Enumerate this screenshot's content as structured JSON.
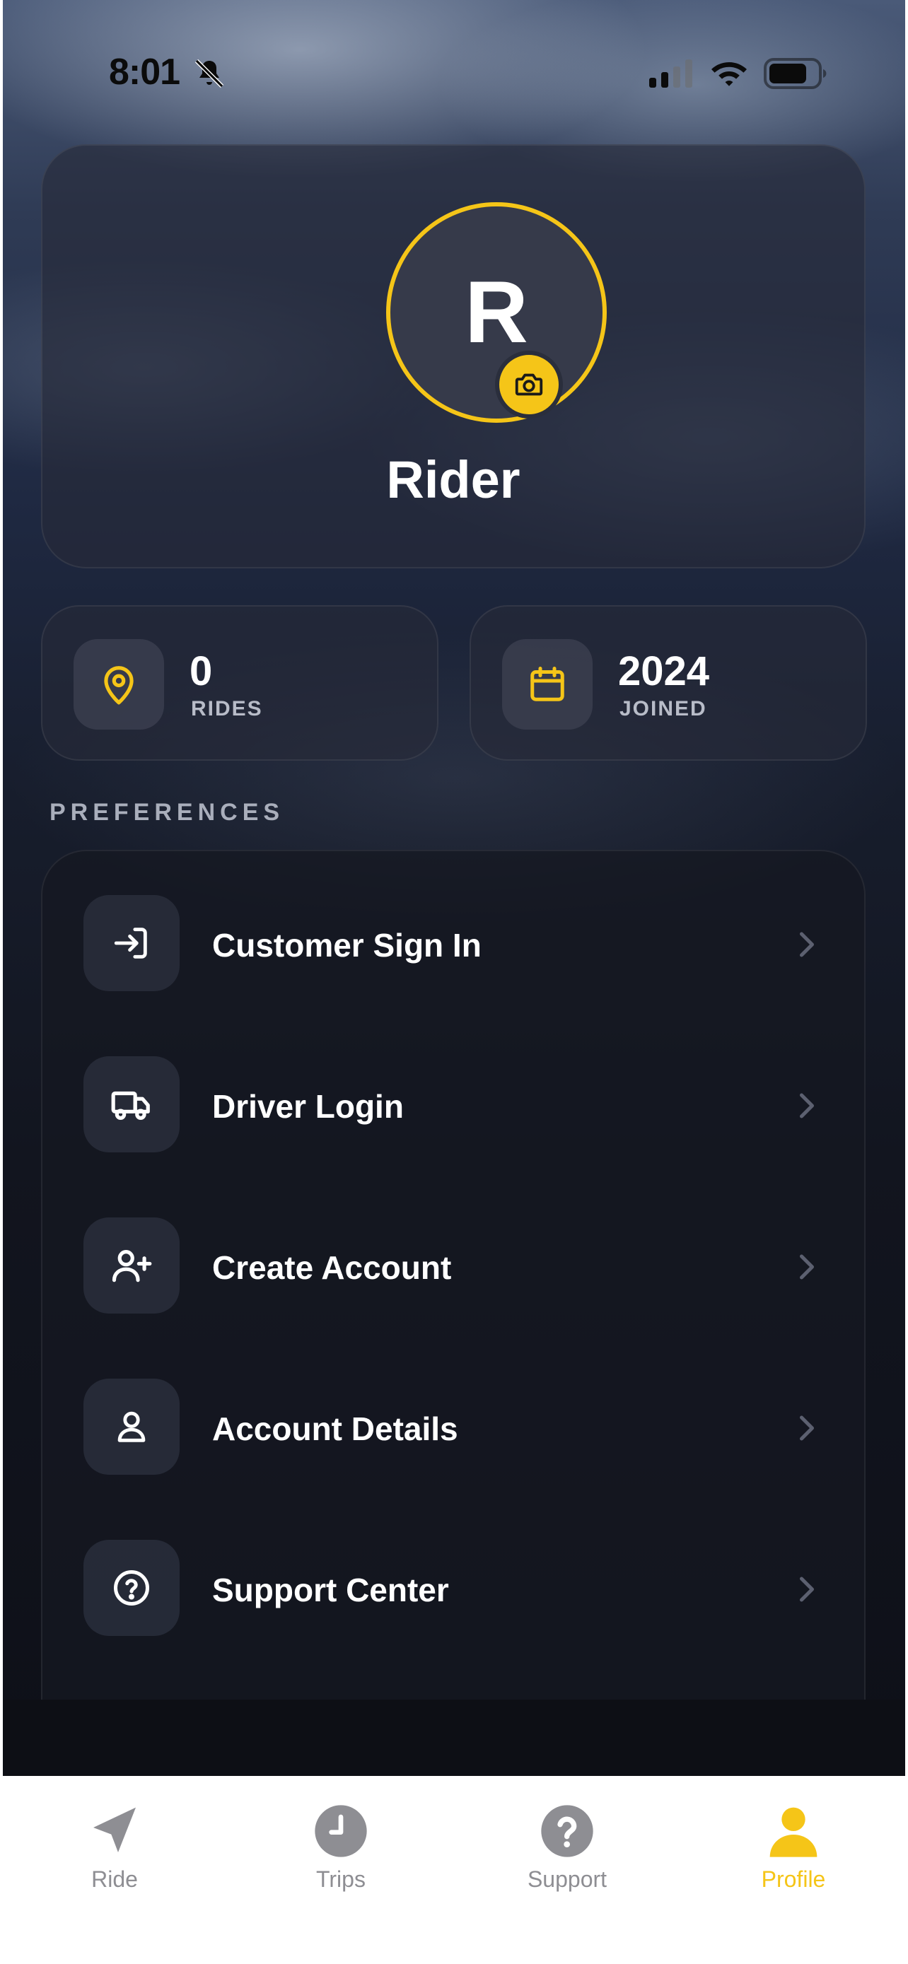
{
  "status_bar": {
    "time": "8:01",
    "icons": [
      "bell-slash-icon",
      "cellular-signal-icon",
      "wifi-icon",
      "battery-icon"
    ]
  },
  "profile": {
    "avatar_initial": "R",
    "name": "Rider",
    "camera_icon": "camera-icon"
  },
  "stats": [
    {
      "value": "0",
      "label": "RIDES",
      "icon": "location-pin-icon"
    },
    {
      "value": "2024",
      "label": "JOINED",
      "icon": "calendar-icon"
    }
  ],
  "preferences": {
    "title": "PREFERENCES",
    "items": [
      {
        "label": "Customer Sign In",
        "icon": "sign-in-icon"
      },
      {
        "label": "Driver Login",
        "icon": "truck-icon"
      },
      {
        "label": "Create Account",
        "icon": "user-plus-icon"
      },
      {
        "label": "Account Details",
        "icon": "user-icon"
      },
      {
        "label": "Support Center",
        "icon": "help-circle-icon"
      }
    ]
  },
  "tabbar": {
    "tabs": [
      {
        "label": "Ride",
        "icon": "navigation-arrow-icon",
        "active": false
      },
      {
        "label": "Trips",
        "icon": "clock-icon",
        "active": false
      },
      {
        "label": "Support",
        "icon": "question-circle-icon",
        "active": false
      },
      {
        "label": "Profile",
        "icon": "person-icon",
        "active": true
      }
    ]
  },
  "colors": {
    "accent": "#f5c518",
    "card_bg": "#262a38",
    "text_primary": "#ffffff",
    "text_secondary": "#b8bcc8",
    "tab_inactive": "#8e8e93"
  }
}
